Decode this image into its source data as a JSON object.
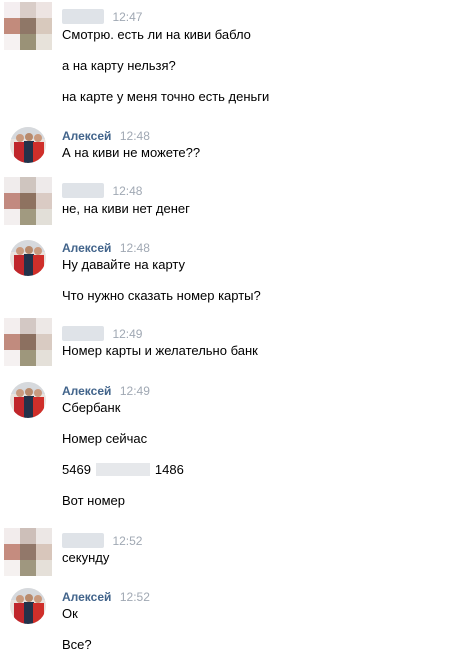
{
  "messages": [
    {
      "sender": "",
      "time": "12:47",
      "lines": [
        "Смотрю. есть ли на киви бабло",
        "а на карту нельзя?",
        "на карте у меня точно есть деньги"
      ]
    },
    {
      "sender": "Алексей",
      "time": "12:48",
      "lines": [
        "А на киви не можете??"
      ]
    },
    {
      "sender": "",
      "time": "12:48",
      "lines": [
        "не, на киви нет денег"
      ]
    },
    {
      "sender": "Алексей",
      "time": "12:48",
      "lines": [
        "Ну давайте на карту",
        "Что нужно сказать номер карты?"
      ]
    },
    {
      "sender": "",
      "time": "12:49",
      "lines": [
        "Номер карты и желательно банк"
      ]
    },
    {
      "sender": "Алексей",
      "time": "12:49",
      "lines": [
        "Сбербанк",
        "Номер сейчас"
      ],
      "card_prefix": "5469",
      "card_suffix": "1486",
      "after_card": "Вот номер"
    },
    {
      "sender": "",
      "time": "12:52",
      "lines": [
        "секунду"
      ]
    },
    {
      "sender": "Алексей",
      "time": "12:52",
      "lines": [
        "Ок",
        "Все?"
      ]
    }
  ],
  "colors": {
    "sender_name": "#42648b",
    "timestamp": "#a0a8b3",
    "text": "#000000"
  }
}
